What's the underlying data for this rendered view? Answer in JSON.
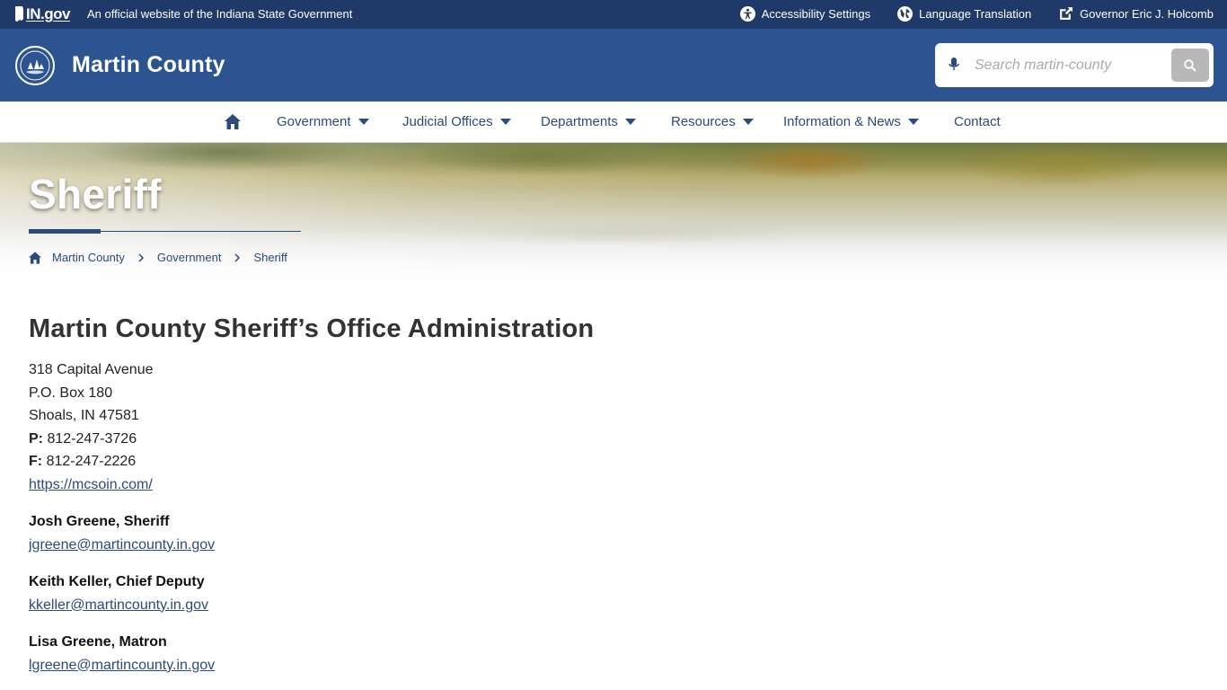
{
  "gov_bar": {
    "logo_text": "IN.gov",
    "official_text": "An official website of the Indiana State Government",
    "links": [
      {
        "label": "Accessibility Settings",
        "icon": "accessibility-icon"
      },
      {
        "label": "Language Translation",
        "icon": "globe-icon"
      },
      {
        "label": "Governor Eric J. Holcomb",
        "icon": "external-link-icon"
      }
    ]
  },
  "header": {
    "county_title": "Martin County",
    "search_placeholder": "Search martin-county"
  },
  "nav": {
    "items": [
      {
        "label": "Government",
        "has_dropdown": true
      },
      {
        "label": "Judicial Offices",
        "has_dropdown": true
      },
      {
        "label": "Departments",
        "has_dropdown": true
      },
      {
        "label": "Resources",
        "has_dropdown": true
      },
      {
        "label": "Information & News",
        "has_dropdown": true
      },
      {
        "label": "Contact",
        "has_dropdown": false
      }
    ]
  },
  "hero": {
    "title": "Sheriff",
    "breadcrumb": [
      "Martin County",
      "Government",
      "Sheriff"
    ]
  },
  "content": {
    "heading": "Martin County Sheriff’s Office Administration",
    "address": [
      "318 Capital Avenue",
      "P.O. Box 180",
      "Shoals, IN 47581"
    ],
    "phone_label": "P:",
    "phone": "812-247-3726",
    "fax_label": "F:",
    "fax": "812-247-2226",
    "website": "https://mcsoin.com/",
    "people": [
      {
        "name": "Josh Greene, Sheriff",
        "email": "jgreene@martincounty.in.gov"
      },
      {
        "name": "Keith Keller, Chief Deputy",
        "email": "kkeller@martincounty.in.gov"
      },
      {
        "name": "Lisa Greene, Matron",
        "email": "lgreene@martincounty.in.gov"
      }
    ]
  },
  "colors": {
    "gov_bar": "#1f3a68",
    "header": "#2c5491",
    "nav_text": "#2c4a7a",
    "link": "#2c4a7a"
  }
}
